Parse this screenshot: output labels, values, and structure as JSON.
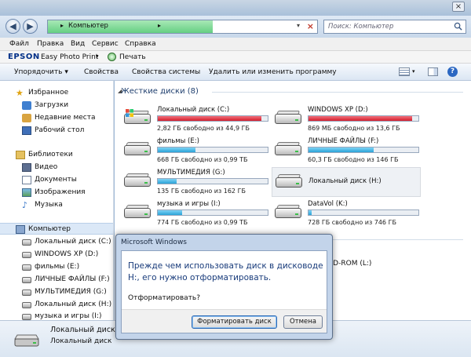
{
  "window": {
    "close_glyph": "×"
  },
  "address": {
    "back_glyph": "◀",
    "forward_glyph": "▶",
    "path": "Компьютер",
    "clear_glyph": "×"
  },
  "search": {
    "placeholder": "Поиск: Компьютер"
  },
  "menu": [
    "Файл",
    "Правка",
    "Вид",
    "Сервис",
    "Справка"
  ],
  "epson": {
    "logo": "EPSON",
    "app": "Easy Photo Print",
    "print": "Печать"
  },
  "commands": {
    "organize": "Упорядочить",
    "properties": "Свойства",
    "system_props": "Свойства системы",
    "uninstall": "Удалить или изменить программу",
    "help_glyph": "?"
  },
  "nav": {
    "favorites": "Избранное",
    "downloads": "Загрузки",
    "recent": "Недавние места",
    "desktop": "Рабочий стол",
    "libraries": "Библиотеки",
    "video": "Видео",
    "documents": "Документы",
    "images": "Изображения",
    "music": "Музыка",
    "computer": "Компьютер",
    "drives": [
      "Локальный диск (C:)",
      "WINDOWS XP (D:)",
      "фильмы (E:)",
      "ЛИЧНЫЕ ФАЙЛЫ (F:)",
      "МУЛЬТИМЕДИЯ (G:)",
      "Локальный диск (H:)",
      "музыка и игры (I:)"
    ]
  },
  "main": {
    "group_title": "Жесткие диски (8)",
    "drives": [
      {
        "name": "Локальный диск (C:)",
        "free": "2,82 ГБ свободно из 44,9 ГБ",
        "used_fraction": 0.94,
        "color": "#d21f2e"
      },
      {
        "name": "WINDOWS XP (D:)",
        "free": "869 МБ свободно из 13,6 ГБ",
        "used_fraction": 0.94,
        "color": "#d21f2e"
      },
      {
        "name": "фильмы (E:)",
        "free": "668 ГБ свободно из 0,99 ТБ",
        "used_fraction": 0.34,
        "color": "#2aa3d8"
      },
      {
        "name": "ЛИЧНЫЕ ФАЙЛЫ (F:)",
        "free": "60,3 ГБ свободно из 146 ГБ",
        "used_fraction": 0.59,
        "color": "#2aa3d8"
      },
      {
        "name": "МУЛЬТИМЕДИЯ (G:)",
        "free": "135 ГБ свободно из 162 ГБ",
        "used_fraction": 0.17,
        "color": "#2aa3d8"
      },
      {
        "name": "Локальный диск (H:)",
        "free": "",
        "used_fraction": 0,
        "color": ""
      },
      {
        "name": "музыка и игры (I:)",
        "free": "774 ГБ свободно из 0,99 ТБ",
        "used_fraction": 0.22,
        "color": "#2aa3d8"
      },
      {
        "name": "DataVol (K:)",
        "free": "728 ГБ свободно из 746 ГБ",
        "used_fraction": 0.03,
        "color": "#2aa3d8"
      }
    ],
    "bd_rom": "BD-ROM (L:)"
  },
  "details": {
    "name": "Локальный диск (H:)",
    "type": "Локальный диск"
  },
  "dialog": {
    "title": "Microsoft Windows",
    "line1": "Прежде чем использовать диск в дисководе",
    "line2": "H:, его нужно отформатировать.",
    "question": "Отформатировать?",
    "format_button": "Форматировать диск",
    "cancel_button": "Отмена"
  }
}
